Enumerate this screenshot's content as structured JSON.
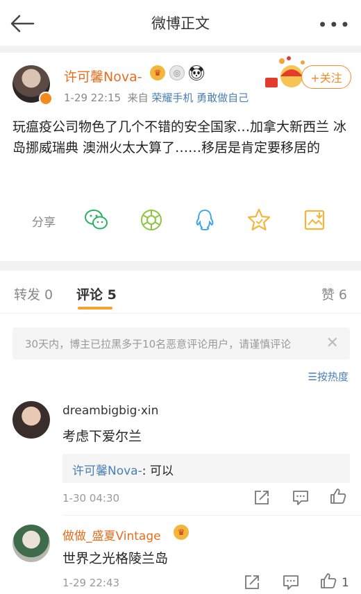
{
  "header": {
    "title": "微博正文"
  },
  "post": {
    "author": "许可馨Nova-",
    "date": "1-29 22:15",
    "from_prefix": "来自",
    "source": "荣耀手机 勇敢做自己",
    "follow_label": "+关注",
    "content": "玩瘟疫公司物色了几个不错的安全国家…加拿大新西兰 冰岛挪威瑞典 澳洲火太大算了……移居是肯定要移居的",
    "share_label": "分享"
  },
  "tabs": {
    "repost": "转发 0",
    "comment": "评论 5",
    "like": "赞 6"
  },
  "notice": {
    "text": "30天内，博主已拉黑多于10名恶意评论用户，请谨慎评论"
  },
  "sort_label": "按热度",
  "comments": [
    {
      "name": "dreambigbig·xin",
      "text": "考虑下爱尔兰",
      "reply_name": "许可馨Nova-",
      "reply_text": ": 可以",
      "time": "1-30 04:30"
    },
    {
      "name": "做做_盛夏Vintage",
      "text": "世界之光格陵兰岛",
      "time": "1-29 22:43",
      "likes": "1"
    }
  ],
  "colors": {
    "accent": "#f7a02d",
    "link": "#4a7fb5",
    "orange_name": "#e86d1f"
  }
}
